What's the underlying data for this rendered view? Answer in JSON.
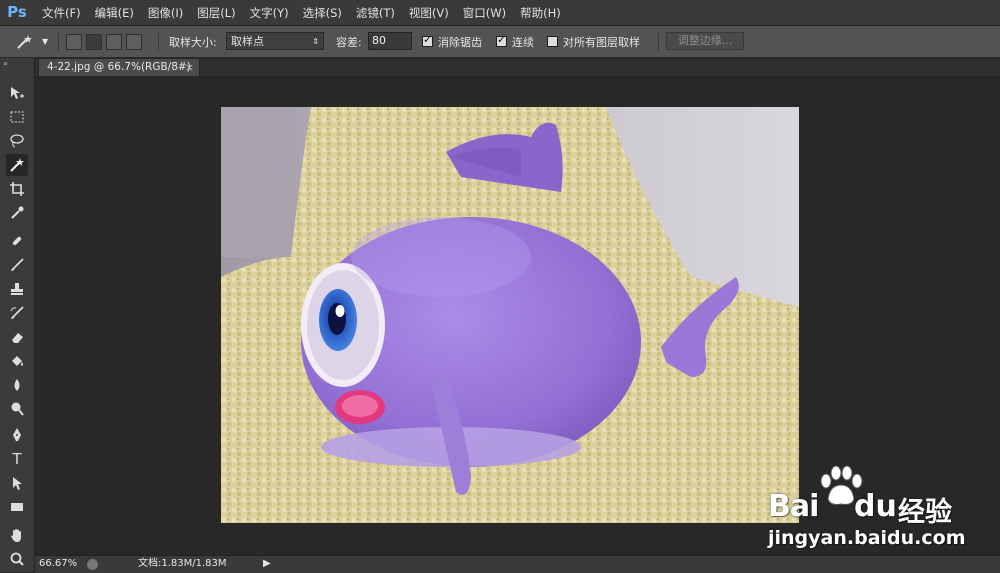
{
  "app": {
    "logo": "Ps"
  },
  "menu": [
    "文件(F)",
    "编辑(E)",
    "图像(I)",
    "图层(L)",
    "文字(Y)",
    "选择(S)",
    "滤镜(T)",
    "视图(V)",
    "窗口(W)",
    "帮助(H)"
  ],
  "options": {
    "sample_size_label": "取样大小:",
    "sample_size_value": "取样点",
    "tolerance_label": "容差:",
    "tolerance_value": "80",
    "antialias_label": "消除锯齿",
    "antialias_checked": true,
    "contiguous_label": "连续",
    "contiguous_checked": true,
    "all_layers_label": "对所有图层取样",
    "all_layers_checked": false,
    "refine_edge_label": "调整边缘..."
  },
  "document": {
    "tab_title": "4-22.jpg @ 66.7%(RGB/8#)",
    "close": "×"
  },
  "tools": [
    "move-icon",
    "marquee-icon",
    "lasso-icon",
    "magic-wand-icon",
    "crop-icon",
    "eyedropper-icon",
    "healing-brush-icon",
    "brush-icon",
    "clone-stamp-icon",
    "history-brush-icon",
    "eraser-icon",
    "paint-bucket-icon",
    "blur-icon",
    "dodge-icon",
    "pen-icon",
    "type-icon",
    "path-selection-icon",
    "rectangle-icon",
    "hand-icon",
    "zoom-icon"
  ],
  "tool_glyphs": {
    "type": "T"
  },
  "status": {
    "zoom": "66.67%",
    "doc_info": "文档:1.83M/1.83M",
    "arrow": "▶"
  },
  "watermark": {
    "brand": "Bai",
    "brand_du": "du",
    "cn": "经验",
    "url": "jingyan.baidu.com"
  },
  "colors": {
    "ps_blue": "#6fb3ff",
    "panel": "#535353",
    "workspace": "#282828",
    "toy_purple": "#9b79d8"
  }
}
